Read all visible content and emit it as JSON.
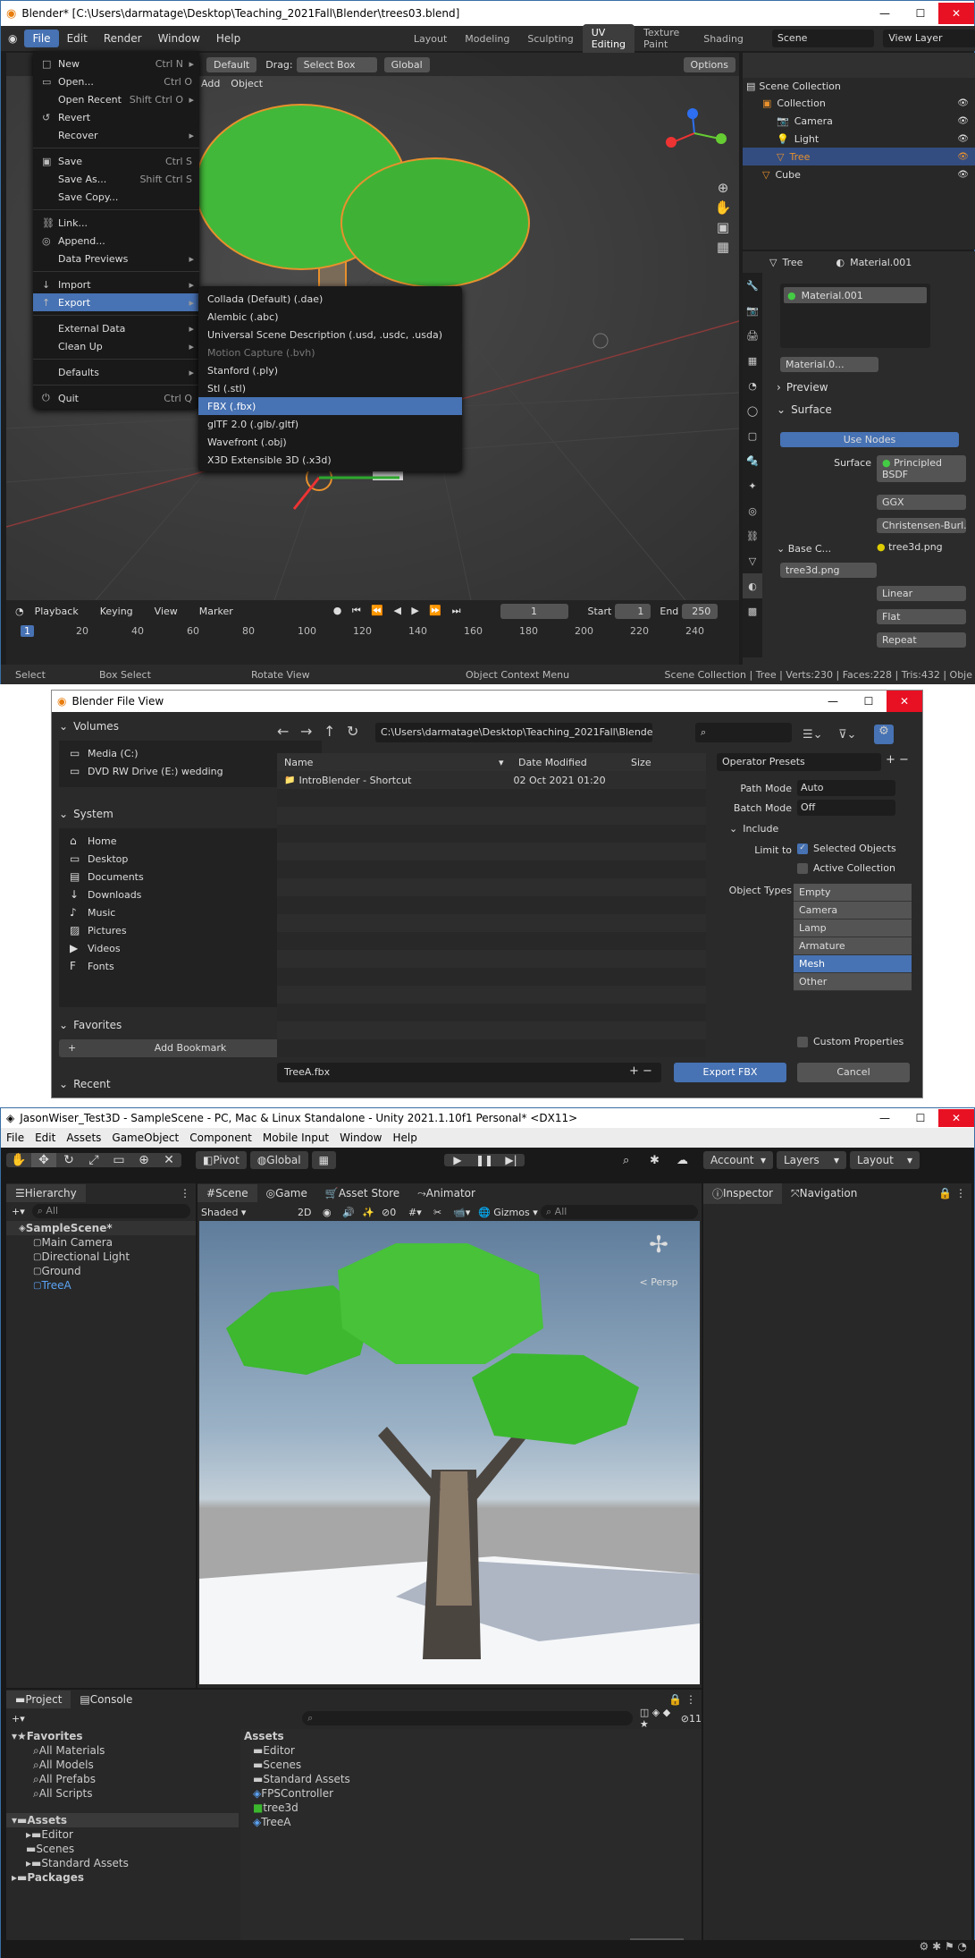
{
  "blender": {
    "title": "Blender* [C:\\Users\\darmatage\\Desktop\\Teaching_2021Fall\\Blender\\trees03.blend]",
    "menu": [
      "File",
      "Edit",
      "Render",
      "Window",
      "Help"
    ],
    "workspaces": [
      "Layout",
      "Modeling",
      "Sculpting",
      "UV Editing",
      "Texture Paint",
      "Shading"
    ],
    "scene": "Scene",
    "view_layer": "View Layer",
    "header": {
      "mode": "Default",
      "drag_label": "Drag:",
      "drag_value": "Select Box",
      "orient": "Global",
      "options": "Options",
      "add": "Add",
      "object": "Object"
    },
    "file_menu": [
      {
        "label": "New",
        "sc": "Ctrl N",
        "ic": "□",
        "arrow": true
      },
      {
        "label": "Open...",
        "sc": "Ctrl O",
        "ic": "▭"
      },
      {
        "label": "Open Recent",
        "sc": "Shift Ctrl O",
        "arrow": true
      },
      {
        "label": "Revert",
        "ic": "↺"
      },
      {
        "label": "Recover",
        "arrow": true
      },
      {
        "sep": true
      },
      {
        "label": "Save",
        "sc": "Ctrl S",
        "ic": "▣"
      },
      {
        "label": "Save As...",
        "sc": "Shift Ctrl S"
      },
      {
        "label": "Save Copy..."
      },
      {
        "sep": true
      },
      {
        "label": "Link...",
        "ic": "⛓"
      },
      {
        "label": "Append...",
        "ic": "◎"
      },
      {
        "label": "Data Previews",
        "arrow": true
      },
      {
        "sep": true
      },
      {
        "label": "Import",
        "ic": "↓",
        "arrow": true
      },
      {
        "label": "Export",
        "ic": "↑",
        "arrow": true,
        "hl": true
      },
      {
        "sep": true
      },
      {
        "label": "External Data",
        "arrow": true
      },
      {
        "label": "Clean Up",
        "arrow": true
      },
      {
        "sep": true
      },
      {
        "label": "Defaults",
        "arrow": true
      },
      {
        "sep": true
      },
      {
        "label": "Quit",
        "sc": "Ctrl Q",
        "ic": "⏻"
      }
    ],
    "export_menu": [
      {
        "label": "Collada (Default) (.dae)"
      },
      {
        "label": "Alembic (.abc)"
      },
      {
        "label": "Universal Scene Description (.usd, .usdc, .usda)"
      },
      {
        "label": "Motion Capture (.bvh)",
        "dis": true
      },
      {
        "label": "Stanford (.ply)"
      },
      {
        "label": "Stl (.stl)"
      },
      {
        "label": "FBX (.fbx)",
        "hl": true
      },
      {
        "label": "glTF 2.0 (.glb/.gltf)"
      },
      {
        "label": "Wavefront (.obj)"
      },
      {
        "label": "X3D Extensible 3D (.x3d)"
      }
    ],
    "outliner": {
      "title": "Scene Collection",
      "items": [
        {
          "label": "Collection",
          "indent": 1
        },
        {
          "label": "Camera",
          "indent": 2
        },
        {
          "label": "Light",
          "indent": 2
        },
        {
          "label": "Tree",
          "indent": 2,
          "sel": true
        },
        {
          "label": "Cube",
          "indent": 1
        }
      ]
    },
    "props": {
      "object": "Tree",
      "material": "Material.001",
      "slot": "Material.001",
      "mat_short": "Material.0...",
      "preview": "Preview",
      "surface": "Surface",
      "use_nodes": "Use Nodes",
      "surface_label": "Surface",
      "surface_val": "Principled BSDF",
      "ggx": "GGX",
      "sss": "Christensen-Burl...",
      "base_color": "Base C...",
      "tex": "tree3d.png",
      "tex2": "tree3d.png",
      "linear": "Linear",
      "flat": "Flat",
      "repeat": "Repeat"
    },
    "timeline": {
      "playback": "Playback",
      "keying": "Keying",
      "view": "View",
      "marker": "Marker",
      "frame": "1",
      "start_label": "Start",
      "start": "1",
      "end_label": "End",
      "end": "250",
      "ticks": [
        "1",
        "20",
        "40",
        "60",
        "80",
        "100",
        "120",
        "140",
        "160",
        "180",
        "200",
        "220",
        "240"
      ]
    },
    "status": {
      "select": "Select",
      "box": "Box Select",
      "rotate": "Rotate View",
      "ctx": "Object Context Menu",
      "info": "Scene Collection | Tree | Verts:230 | Faces:228 | Tris:432 | Obje"
    }
  },
  "fileview": {
    "title": "Blender File View",
    "volumes_label": "Volumes",
    "volumes": [
      "Media (C:)",
      "DVD RW Drive (E:) wedding"
    ],
    "system_label": "System",
    "system": [
      "Home",
      "Desktop",
      "Documents",
      "Downloads",
      "Music",
      "Pictures",
      "Videos",
      "Fonts"
    ],
    "favorites_label": "Favorites",
    "add_bookmark": "Add Bookmark",
    "recent_label": "Recent",
    "path": "C:\\Users\\darmatage\\Desktop\\Teaching_2021Fall\\Blender\\",
    "col_name": "Name",
    "col_date": "Date Modified",
    "col_size": "Size",
    "files": [
      {
        "name": "IntroBlender - Shortcut",
        "date": "02 Oct 2021 01:20"
      }
    ],
    "presets": "Operator Presets",
    "path_mode_label": "Path Mode",
    "path_mode": "Auto",
    "batch_label": "Batch Mode",
    "batch": "Off",
    "include": "Include",
    "limit_label": "Limit to",
    "selected_objects": "Selected Objects",
    "active_collection": "Active Collection",
    "obj_types_label": "Object Types",
    "obj_types": [
      "Empty",
      "Camera",
      "Lamp",
      "Armature",
      "Mesh",
      "Other"
    ],
    "custom_props": "Custom Properties",
    "filename": "TreeA.fbx",
    "export_btn": "Export FBX",
    "cancel_btn": "Cancel"
  },
  "unity": {
    "title": "JasonWiser_Test3D - SampleScene - PC, Mac & Linux Standalone - Unity 2021.1.10f1 Personal* <DX11>",
    "menu": [
      "File",
      "Edit",
      "Assets",
      "GameObject",
      "Component",
      "Mobile Input",
      "Window",
      "Help"
    ],
    "pivot": "Pivot",
    "global": "Global",
    "account": "Account",
    "layers": "Layers",
    "layout": "Layout",
    "hierarchy_tab": "Hierarchy",
    "search_all": "All",
    "hierarchy": [
      {
        "label": "SampleScene*",
        "indent": 0
      },
      {
        "label": "Main Camera",
        "indent": 1
      },
      {
        "label": "Directional Light",
        "indent": 1
      },
      {
        "label": "Ground",
        "indent": 1
      },
      {
        "label": "TreeA",
        "indent": 1,
        "blue": true
      }
    ],
    "scene_tabs": [
      "Scene",
      "Game",
      "Asset Store",
      "Animator"
    ],
    "shaded": "Shaded",
    "twod": "2D",
    "gizmos": "Gizmos",
    "persp": "< Persp",
    "gizmo_count": "0",
    "inspector": "Inspector",
    "navigation": "Navigation",
    "project_tab": "Project",
    "console_tab": "Console",
    "favorites_label": "Favorites",
    "favorites": [
      "All Materials",
      "All Models",
      "All Prefabs",
      "All Scripts"
    ],
    "assets_label": "Assets",
    "assets_tree": [
      "Editor",
      "Scenes",
      "Standard Assets"
    ],
    "packages": "Packages",
    "assets_header": "Assets",
    "assets_list": [
      "Editor",
      "Scenes",
      "Standard Assets",
      "FPSController",
      "tree3d",
      "TreeA"
    ],
    "hidden_count": "11"
  }
}
